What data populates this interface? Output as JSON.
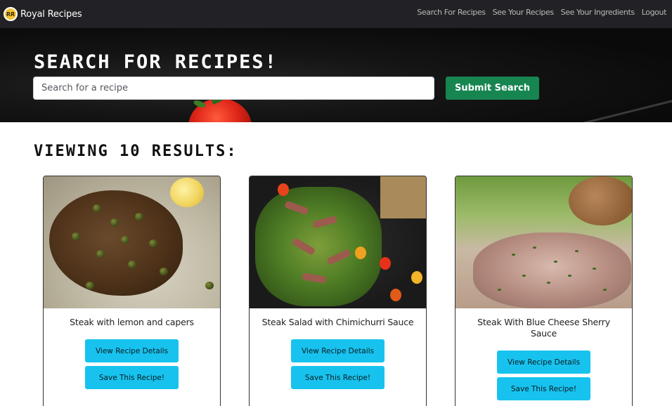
{
  "navbar": {
    "brand_logo_text": "RR",
    "brand_name": "Royal Recipes",
    "links": [
      {
        "label": "Search For Recipes"
      },
      {
        "label": "See Your Recipes"
      },
      {
        "label": "See Your Ingredients"
      },
      {
        "label": "Logout"
      }
    ]
  },
  "hero": {
    "title": "SEARCH FOR RECIPES!",
    "search": {
      "placeholder": "Search for a recipe",
      "value": ""
    },
    "submit_label": "Submit Search"
  },
  "results": {
    "heading": "VIEWING 10 RESULTS:",
    "cards": [
      {
        "title": "Steak with lemon and capers",
        "details_label": "View Recipe Details",
        "save_label": "Save This Recipe!"
      },
      {
        "title": "Steak Salad with Chimichurri Sauce",
        "details_label": "View Recipe Details",
        "save_label": "Save This Recipe!"
      },
      {
        "title": "Steak With Blue Cheese Sherry Sauce",
        "details_label": "View Recipe Details",
        "save_label": "Save This Recipe!"
      }
    ]
  },
  "colors": {
    "navbar_bg": "#222226",
    "submit_button": "#178550",
    "card_button": "#17c3ee"
  }
}
